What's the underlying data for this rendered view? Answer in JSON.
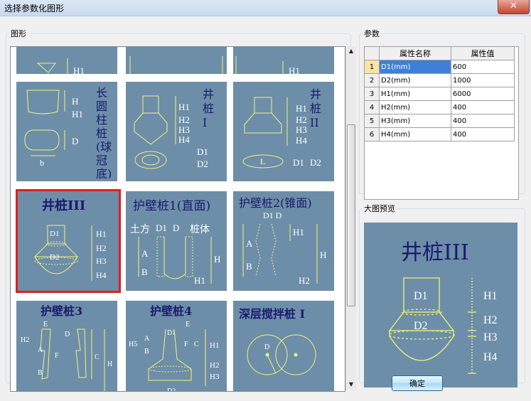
{
  "window": {
    "title": "选择参数化图形",
    "close_glyph": "✕"
  },
  "shapes_panel": {
    "label": "图形"
  },
  "params_panel": {
    "label": "参数",
    "col_name": "属性名称",
    "col_value": "属性值",
    "rows": [
      {
        "index": "1",
        "name": "D1(mm)",
        "value": "600"
      },
      {
        "index": "2",
        "name": "D2(mm)",
        "value": "1000"
      },
      {
        "index": "3",
        "name": "H1(mm)",
        "value": "6000"
      },
      {
        "index": "4",
        "name": "H2(mm)",
        "value": "400"
      },
      {
        "index": "5",
        "name": "H3(mm)",
        "value": "400"
      },
      {
        "index": "6",
        "name": "H4(mm)",
        "value": "400"
      }
    ]
  },
  "preview_panel": {
    "label": "大图预览",
    "title": "井桩III",
    "labels": {
      "d1": "D1",
      "d2": "D2",
      "h1": "H1",
      "h2": "H2",
      "h3": "H3",
      "h4": "H4"
    }
  },
  "tiles": [
    {
      "title": "",
      "labels": {
        "h1": "H1"
      }
    },
    {
      "title": "",
      "labels": {}
    },
    {
      "title": "",
      "labels": {
        "h1": "H1"
      }
    },
    {
      "title": "长圆柱桩(球冠底)",
      "labels": {
        "h": "H",
        "h1": "H1",
        "d": "D",
        "b": "b"
      }
    },
    {
      "title": "井桩I",
      "labels": {
        "h1": "H1",
        "h2": "H2",
        "h3": "H3",
        "h4": "H4",
        "d1": "D1",
        "d2": "D2"
      }
    },
    {
      "title": "井桩II",
      "labels": {
        "h1": "H1",
        "h2": "H2",
        "h3": "H3",
        "h4": "H4",
        "l": "L",
        "d1": "D1",
        "d2": "D2"
      }
    },
    {
      "title": "井桩III",
      "labels": {
        "d1": "D1",
        "d2": "D2",
        "h1": "H1",
        "h2": "H2",
        "h3": "H3",
        "h4": "H4"
      }
    },
    {
      "title": "护壁桩1(直面)",
      "labels": {
        "soil": "土方",
        "d1": "D1",
        "d": "D",
        "body": "桩体",
        "a": "A",
        "b": "B",
        "h": "H",
        "h1": "H1"
      }
    },
    {
      "title": "护壁桩2(锥面)",
      "labels": {
        "d1d": "D1 D",
        "h1": "H1",
        "a": "A",
        "b": "B",
        "h": "H",
        "h2": "H2"
      }
    },
    {
      "title": "护壁桩3",
      "labels": {
        "e": "E",
        "d": "D",
        "h2": "H2",
        "a": "A",
        "f": "F",
        "c": "C",
        "h": "H",
        "b": "B"
      }
    },
    {
      "title": "护壁桩4",
      "labels": {
        "h5": "H5",
        "a": "A",
        "b": "B",
        "d1": "D1",
        "e": "E",
        "f": "F",
        "c": "C",
        "h1": "H1",
        "h2": "H2",
        "h3": "H3",
        "d2": "D2"
      }
    },
    {
      "title": "深层搅拌桩 I",
      "labels": {
        "d": "D"
      }
    }
  ],
  "ok_button": "确定"
}
